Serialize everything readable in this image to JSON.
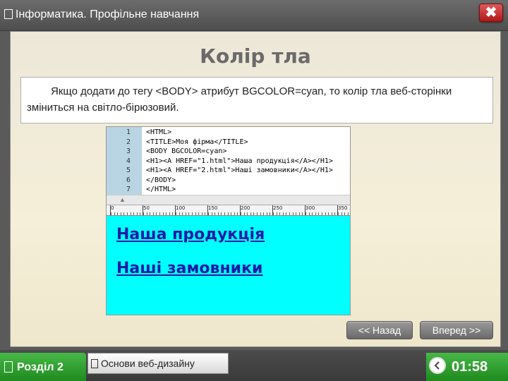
{
  "window": {
    "title": "Інформатика. Профільне навчання",
    "close_label": "✖"
  },
  "slide": {
    "title": "Колір тла",
    "text": "Якщо додати до тегу <BODY> атрибут BGCOLOR=cyan, то колір тла веб-сторінки зміниться на світло-бірюзовий."
  },
  "editor": {
    "lines": [
      {
        "num": "1",
        "code": "<HTML>"
      },
      {
        "num": "2",
        "code": "<TITLE>Моя фірма</TITLE>"
      },
      {
        "num": "3",
        "code": "<BODY BGCOLOR=cyan>"
      },
      {
        "num": "4",
        "code": "<H1><A HREF=\"1.html\">Наша продукція</A></H1>"
      },
      {
        "num": "5",
        "code": "<H1><A HREF=\"2.html\">Наші замовники</A></H1>"
      },
      {
        "num": "6",
        "code": "</BODY>"
      },
      {
        "num": "7",
        "code": "</HTML>"
      }
    ]
  },
  "ruler": {
    "ticks": [
      "0",
      "50",
      "100",
      "150",
      "200",
      "250",
      "300",
      "350"
    ]
  },
  "browser": {
    "background": "#00ffff",
    "links": [
      "Наша продукція",
      "Наші замовники"
    ]
  },
  "nav": {
    "back_label": "<< Назад",
    "next_label": "Вперед >>"
  },
  "footer": {
    "section_label": "Розділ 2",
    "topic_label": "Основи веб-дизайну",
    "timer": "01:58"
  },
  "colors": {
    "accent_green": "#2a9a2a",
    "close_red": "#c02020",
    "link_blue": "#1a1aa8"
  }
}
